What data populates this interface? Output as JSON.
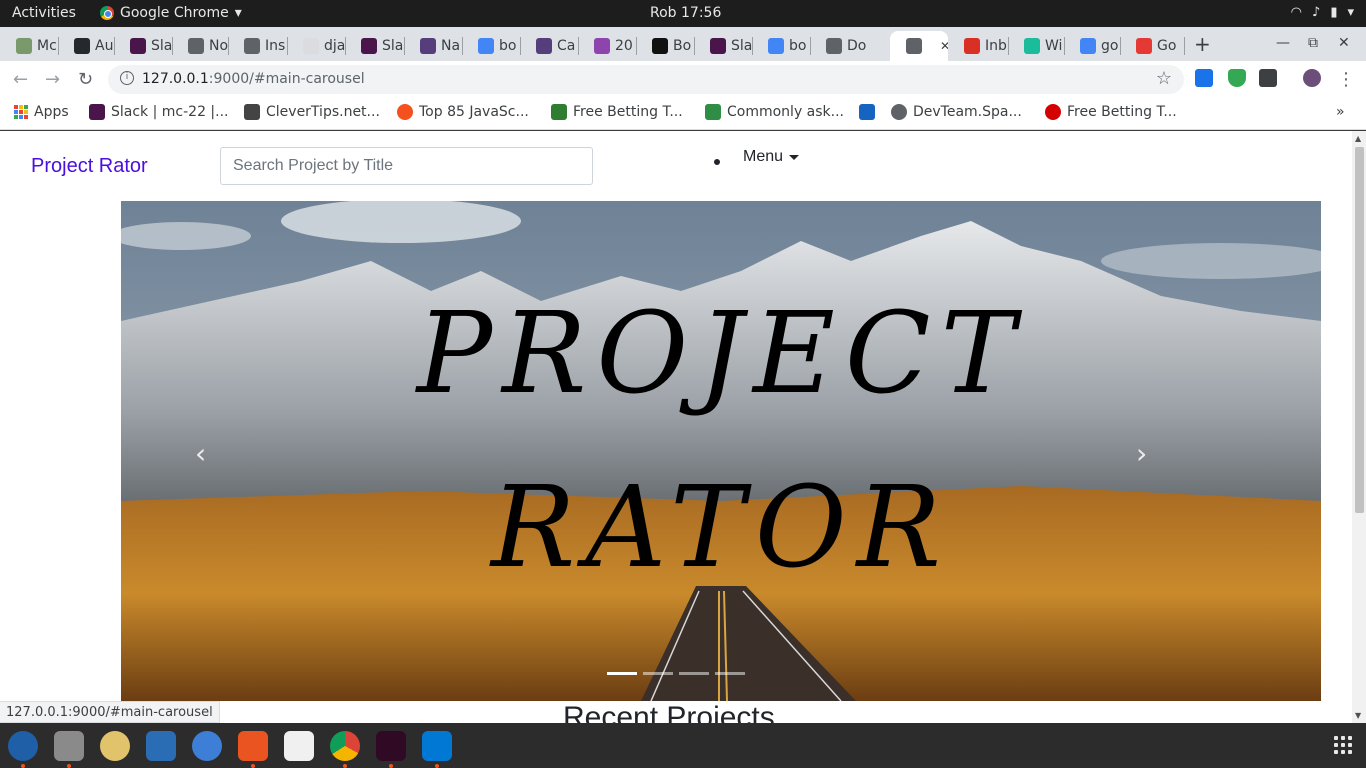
{
  "topbar": {
    "activities": "Activities",
    "app_name": "Google Chrome",
    "clock": "Rob 17:56"
  },
  "tabs": [
    {
      "label": "Mc",
      "icon": "plant-icon",
      "color": "#7a9a6b"
    },
    {
      "label": "Au",
      "icon": "github-icon",
      "color": "#24292e"
    },
    {
      "label": "Sla",
      "icon": "slack-icon",
      "color": "#4a154b"
    },
    {
      "label": "No",
      "icon": "globe-icon",
      "color": "#5f6368"
    },
    {
      "label": "Ins",
      "icon": "building-icon",
      "color": "#5f6368"
    },
    {
      "label": "dja",
      "icon": "blank-page-icon",
      "color": "#dadce0"
    },
    {
      "label": "Sla",
      "icon": "slack-icon",
      "color": "#4a154b"
    },
    {
      "label": "Na",
      "icon": "bootstrap-icon",
      "color": "#563d7c"
    },
    {
      "label": "bo",
      "icon": "google-icon",
      "color": "#4285f4"
    },
    {
      "label": "Ca",
      "icon": "bootstrap-icon",
      "color": "#563d7c"
    },
    {
      "label": "20",
      "icon": "colorlib-icon",
      "color": "#8e44ad"
    },
    {
      "label": "Bo",
      "icon": "codepen-icon",
      "color": "#111111"
    },
    {
      "label": "Sla",
      "icon": "slack-icon",
      "color": "#4a154b"
    },
    {
      "label": "bo",
      "icon": "google-icon",
      "color": "#4285f4"
    },
    {
      "label": "Do",
      "icon": "globe-icon",
      "color": "#5f6368"
    },
    {
      "label": "",
      "icon": "globe-icon",
      "color": "#5f6368",
      "active": true
    },
    {
      "label": "Inb",
      "icon": "gmail-icon",
      "color": "#d93025"
    },
    {
      "label": "Wi",
      "icon": "d-icon",
      "color": "#1abc9c"
    },
    {
      "label": "go",
      "icon": "google-icon",
      "color": "#4285f4"
    },
    {
      "label": "Go",
      "icon": "f-icon",
      "color": "#e53935"
    }
  ],
  "omnibox": {
    "host": "127.0.0.1",
    "rest": ":9000/#main-carousel"
  },
  "bookmarks": [
    {
      "label": "Apps",
      "icon": "apps-grid-icon"
    },
    {
      "label": "Slack | mc-22 |...",
      "icon": "slack-icon",
      "color": "#4a154b"
    },
    {
      "label": "CleverTips.net...",
      "icon": "clevertips-icon",
      "color": "#444444"
    },
    {
      "label": "Top 85 JavaSc...",
      "icon": "orange-circle-icon",
      "color": "#f4511e"
    },
    {
      "label": "Free Betting T...",
      "icon": "betting-icon",
      "color": "#2e7d32"
    },
    {
      "label": "Commonly ask...",
      "icon": "geeksforgeeks-icon",
      "color": "#2f8d46"
    },
    {
      "label": "",
      "icon": "ibb-icon",
      "color": "#1565c0"
    },
    {
      "label": "DevTeam.Spa...",
      "icon": "globe-icon",
      "color": "#5f6368"
    },
    {
      "label": "Free Betting T...",
      "icon": "red-circle-icon",
      "color": "#d50000"
    }
  ],
  "page": {
    "brand": "Project Rator",
    "search_placeholder": "Search Project by Title",
    "menu_label": "Menu",
    "hero_line1": "PROJECT",
    "hero_line2": "RATOR",
    "indicator_count": 4,
    "active_indicator": 1,
    "recent_heading": "Recent Projects"
  },
  "status_url": "127.0.0.1:9000/#main-carousel",
  "colors": {
    "brand": "#4b0fe0",
    "ubuntu_orange": "#e95420"
  },
  "dock": [
    {
      "icon": "thunderbird-icon",
      "color": "#1f5fa8"
    },
    {
      "icon": "files-icon",
      "color": "#8a8a8a"
    },
    {
      "icon": "rhythmbox-icon",
      "color": "#e0c36a"
    },
    {
      "icon": "libreoffice-writer-icon",
      "color": "#2a6db5"
    },
    {
      "icon": "help-icon",
      "color": "#3d7fd6"
    },
    {
      "icon": "software-center-icon",
      "color": "#e95420"
    },
    {
      "icon": "amazon-icon",
      "color": "#f0f0f0"
    },
    {
      "icon": "chrome-icon",
      "color": "#4285f4"
    },
    {
      "icon": "terminal-icon",
      "color": "#300a24"
    },
    {
      "icon": "vscode-icon",
      "color": "#0078d4"
    }
  ]
}
